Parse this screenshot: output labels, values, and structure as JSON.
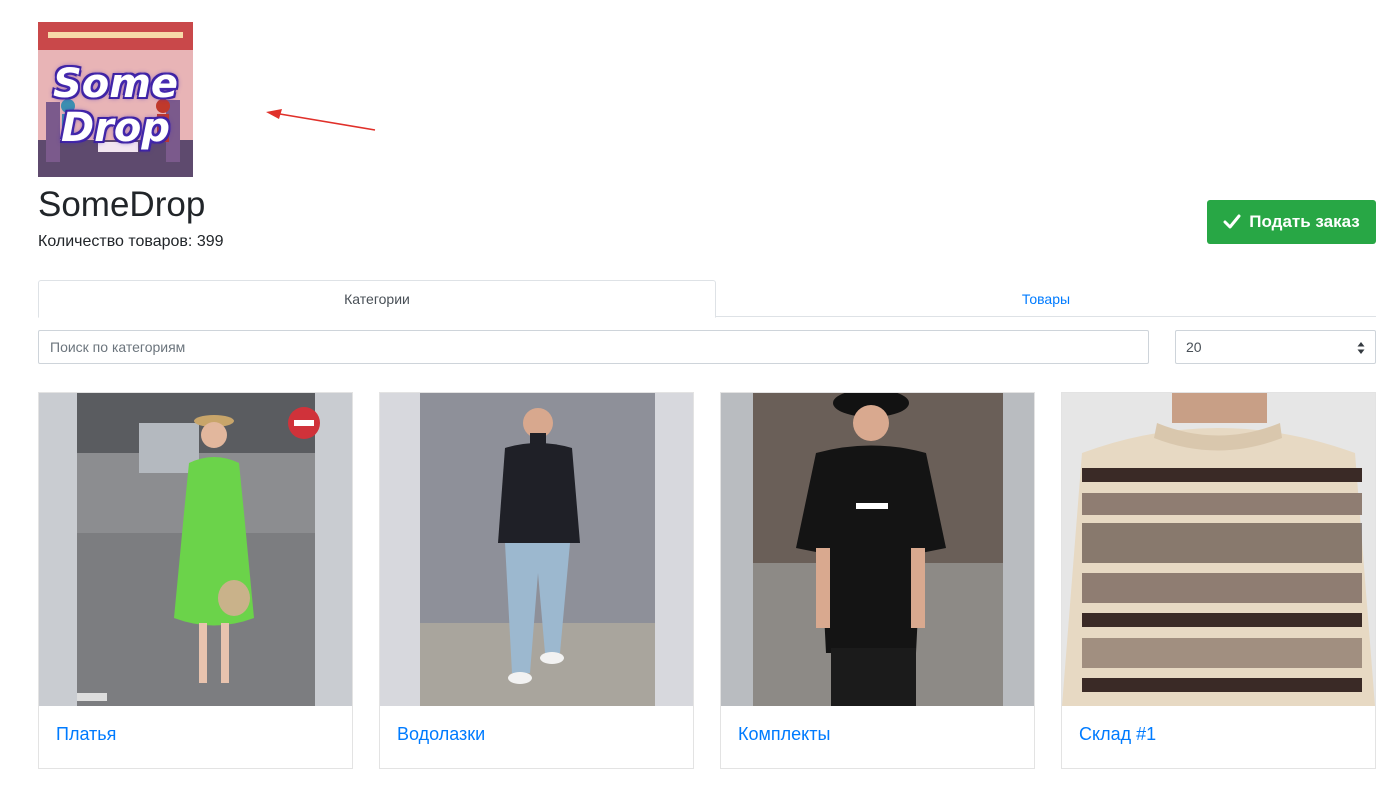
{
  "logo": {
    "line1": "Some",
    "line2": "Drop"
  },
  "shop": {
    "name": "SomeDrop",
    "goods_count_label": "Количество товаров:",
    "goods_count": "399"
  },
  "order_button": {
    "label": "Подать заказ",
    "icon": "check-icon",
    "color": "#28a745"
  },
  "tabs": [
    {
      "label": "Категории",
      "active": true
    },
    {
      "label": "Товары",
      "active": false
    }
  ],
  "search": {
    "placeholder": "Поиск по категориям",
    "value": ""
  },
  "page_size": {
    "selected": "20"
  },
  "categories": [
    {
      "title": "Платья"
    },
    {
      "title": "Водолазки"
    },
    {
      "title": "Комплекты"
    },
    {
      "title": "Склад #1"
    }
  ],
  "colors": {
    "link": "#007bff",
    "accent": "#28a745",
    "arrow": "#e0302a"
  }
}
